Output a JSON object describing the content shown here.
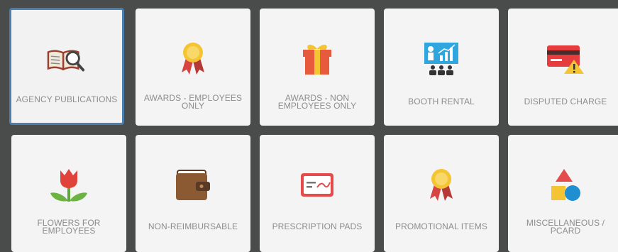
{
  "tiles": [
    {
      "label": "AGENCY PUBLICATIONS",
      "icon": "open-book-magnifier-icon",
      "selected": true
    },
    {
      "label": "AWARDS - EMPLOYEES ONLY",
      "icon": "award-ribbon-icon"
    },
    {
      "label": "AWARDS - NON EMPLOYEES ONLY",
      "icon": "gift-box-icon"
    },
    {
      "label": "BOOTH RENTAL",
      "icon": "presentation-audience-icon"
    },
    {
      "label": "DISPUTED CHARGE",
      "icon": "credit-card-warning-icon"
    },
    {
      "label": "FLOWERS FOR EMPLOYEES",
      "icon": "tulip-icon"
    },
    {
      "label": "NON-REIMBURSABLE",
      "icon": "wallet-icon"
    },
    {
      "label": "PRESCRIPTION PADS",
      "icon": "prescription-pad-icon"
    },
    {
      "label": "PROMOTIONAL ITEMS",
      "icon": "award-ribbon-icon"
    },
    {
      "label": "MISCELLANEOUS / PCARD",
      "icon": "shapes-icon"
    }
  ],
  "colors": {
    "background": "#4a4b4b",
    "tile": "#f4f4f4",
    "selected_border": "#4a7fb0",
    "label": "#8d8d8d"
  }
}
